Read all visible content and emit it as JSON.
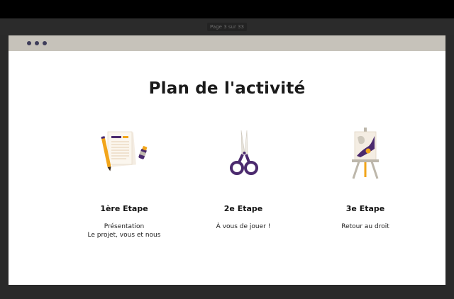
{
  "viewer": {
    "page_indicator": "Page 3 sur 33"
  },
  "slide": {
    "title": "Plan de l'activité",
    "steps": [
      {
        "title": "1ère Etape",
        "lines": [
          "Présentation",
          "Le projet, vous et nous"
        ],
        "icon": "document-pencil-icon"
      },
      {
        "title": "2e Etape",
        "lines": [
          "À vous de jouer !"
        ],
        "icon": "scissors-icon"
      },
      {
        "title": "3e Etape",
        "lines": [
          "Retour au droit"
        ],
        "icon": "easel-painting-icon"
      }
    ]
  },
  "colors": {
    "header": "#c6c2ba",
    "dots": "#3e3d5a",
    "accent_purple": "#4b2a6e",
    "accent_orange": "#f2a51a"
  }
}
